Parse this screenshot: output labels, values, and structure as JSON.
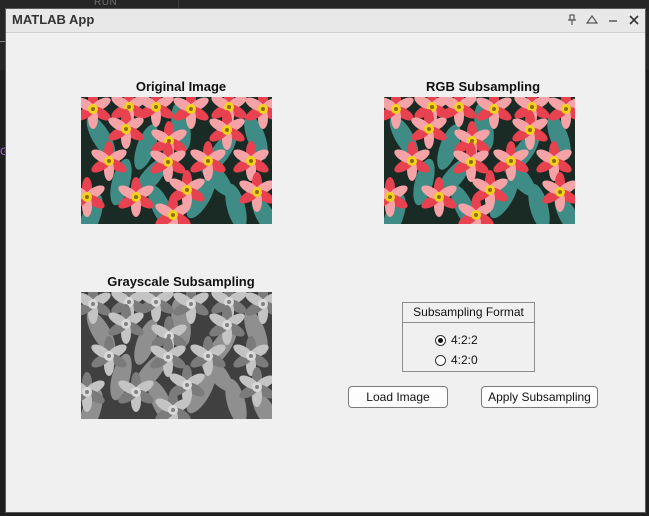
{
  "background": {
    "tab_label": "RUN",
    "left_glyph": "G"
  },
  "window": {
    "title": "MATLAB App"
  },
  "axes": {
    "original": {
      "title": "Original Image"
    },
    "rgb": {
      "title": "RGB Subsampling"
    },
    "gray": {
      "title": "Grayscale Subsampling"
    }
  },
  "format_group": {
    "title": "Subsampling Format",
    "options": [
      {
        "label": "4:2:2",
        "selected": true
      },
      {
        "label": "4:2:0",
        "selected": false
      }
    ]
  },
  "buttons": {
    "load": "Load Image",
    "apply": "Apply Subsampling"
  },
  "icons": {
    "pin": "pin-icon",
    "expand": "expand-icon",
    "minimize": "minimize-icon",
    "close": "close-icon"
  }
}
